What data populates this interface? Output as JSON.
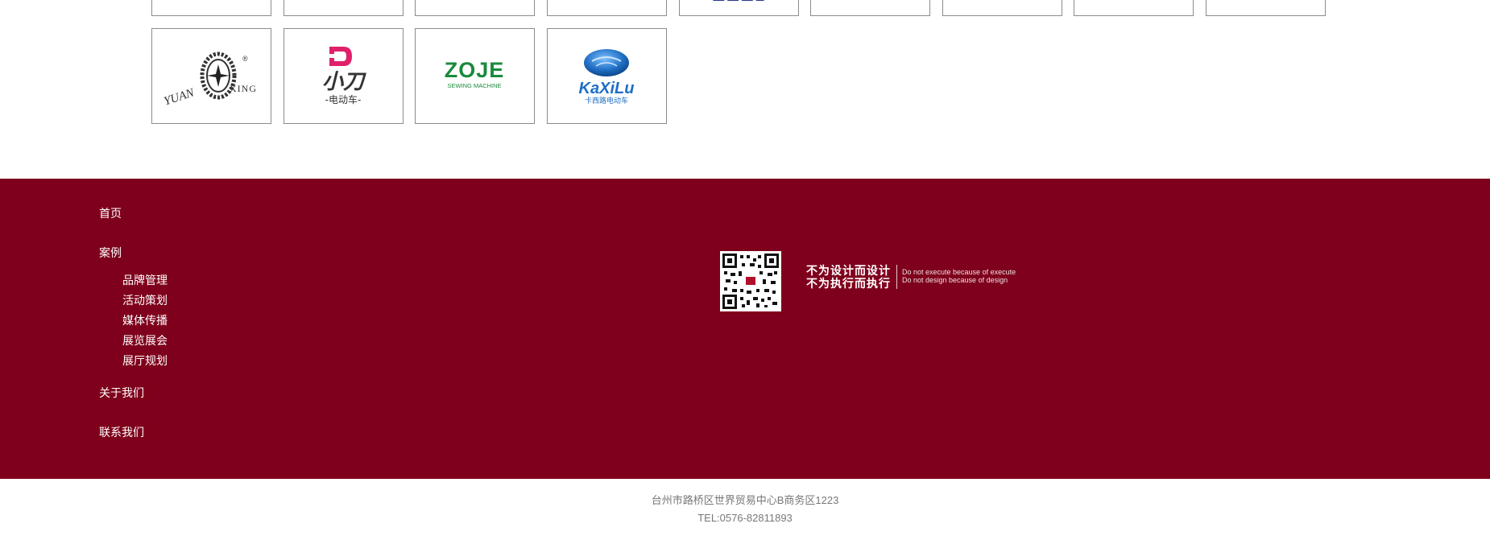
{
  "partner_logos": [
    {
      "name": "Yuan Xing",
      "text_left": "YUAN",
      "text_right": "XING",
      "mark": "®"
    },
    {
      "name": "Xiaodao",
      "brand_cn": "小刀",
      "sub_cn": "-电动车-"
    },
    {
      "name": "ZOJE",
      "brand": "ZOJE",
      "sub": "SEWING MACHINE"
    },
    {
      "name": "KaXiLu",
      "brand": "KaXiLu",
      "sub_cn": "卡西路电动车"
    }
  ],
  "colors": {
    "footer_bg": "#7f001c",
    "zoje_green": "#1a8a3c",
    "xiaodao_pink": "#e0206a",
    "kaxilu_blue": "#1f6fc4"
  },
  "footer": {
    "nav": [
      {
        "label": "首页"
      },
      {
        "label": "案例",
        "children": [
          "品牌管理",
          "活动策划",
          "媒体传播",
          "展览展会",
          "展厅规划"
        ]
      },
      {
        "label": "关于我们"
      },
      {
        "label": "联系我们"
      }
    ],
    "slogan_cn": [
      "不为设计而设计",
      "不为执行而执行"
    ],
    "slogan_en": [
      "Do not execute because of execute",
      "Do not design because of design"
    ]
  },
  "bottom": {
    "address": "台州市路桥区世界贸易中心B商务区1223",
    "tel": "TEL:0576-82811893"
  }
}
